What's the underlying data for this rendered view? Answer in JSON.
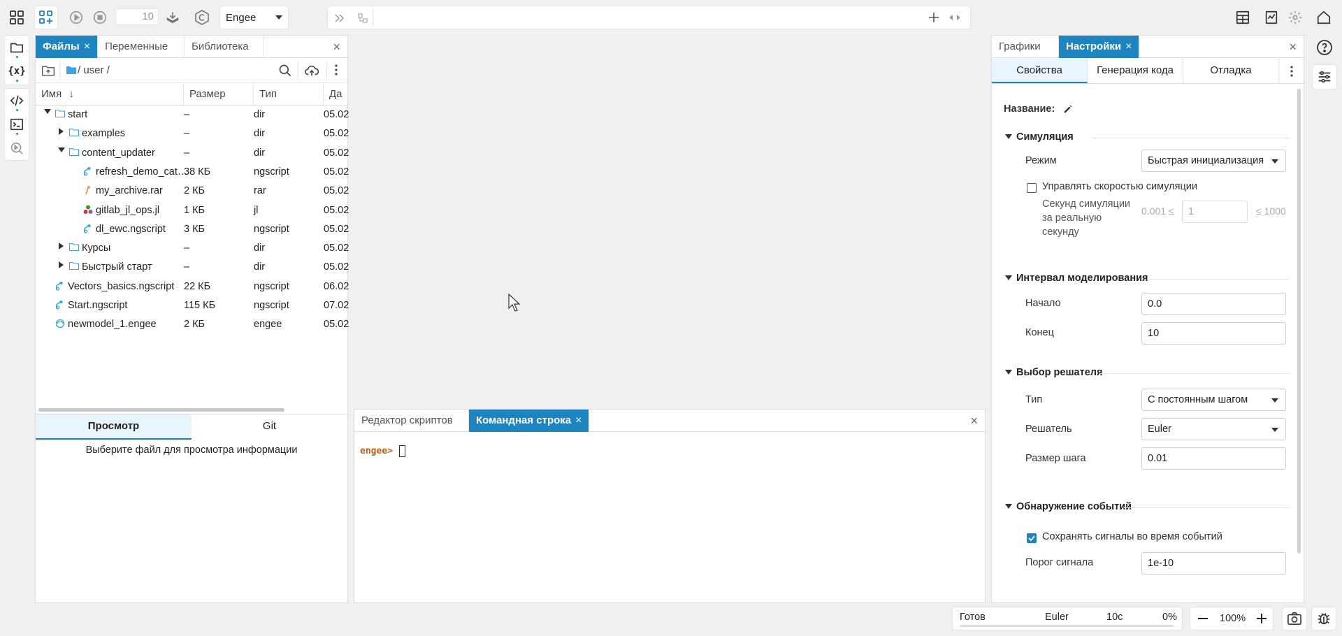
{
  "toolbar": {
    "step_value": "10",
    "engine": "Engee"
  },
  "files_panel": {
    "tabs": [
      {
        "label": "Файлы",
        "active": true
      },
      {
        "label": "Переменные",
        "active": false
      },
      {
        "label": "Библиотека",
        "active": false
      }
    ],
    "path": "/ user /",
    "columns": [
      "Имя",
      "Размер",
      "Тип",
      "Да"
    ],
    "rows": [
      {
        "name": "start",
        "size": "–",
        "type": "dir",
        "date": "05.02"
      },
      {
        "name": "examples",
        "size": "–",
        "type": "dir",
        "date": "05.02"
      },
      {
        "name": "content_updater",
        "size": "–",
        "type": "dir",
        "date": "05.02"
      },
      {
        "name": "refresh_demo_cat…",
        "size": "38 КБ",
        "type": "ngscript",
        "date": "05.02"
      },
      {
        "name": "my_archive.rar",
        "size": "2 КБ",
        "type": "rar",
        "date": "05.02"
      },
      {
        "name": "gitlab_jl_ops.jl",
        "size": "1 КБ",
        "type": "jl",
        "date": "05.02"
      },
      {
        "name": "dl_ewc.ngscript",
        "size": "3 КБ",
        "type": "ngscript",
        "date": "05.02"
      },
      {
        "name": "Курсы",
        "size": "–",
        "type": "dir",
        "date": "05.02"
      },
      {
        "name": "Быстрый старт",
        "size": "–",
        "type": "dir",
        "date": "05.02"
      },
      {
        "name": "Vectors_basics.ngscript",
        "size": "22 КБ",
        "type": "ngscript",
        "date": "06.02"
      },
      {
        "name": "Start.ngscript",
        "size": "115 КБ",
        "type": "ngscript",
        "date": "07.02"
      },
      {
        "name": "newmodel_1.engee",
        "size": "2 КБ",
        "type": "engee",
        "date": "05.02"
      }
    ],
    "sub_tabs": [
      {
        "label": "Просмотр",
        "active": true
      },
      {
        "label": "Git",
        "active": false
      }
    ],
    "preview_message": "Выберите файл для просмотра информации"
  },
  "console_panel": {
    "tabs": [
      {
        "label": "Редактор скриптов",
        "active": false
      },
      {
        "label": "Командная строка",
        "active": true
      }
    ],
    "prompt": "engee>"
  },
  "settings_panel": {
    "tabs": [
      {
        "label": "Графики",
        "active": false
      },
      {
        "label": "Настройки",
        "active": true
      }
    ],
    "sub_tabs": [
      {
        "label": "Свойства",
        "active": true
      },
      {
        "label": "Генерация кода",
        "active": false
      },
      {
        "label": "Отладка",
        "active": false
      }
    ],
    "name_label": "Название:",
    "simulation": {
      "title": "Симуляция",
      "mode_label": "Режим",
      "mode_value": "Быстрая инициализация",
      "control_speed_label": "Управлять скоростью симуляции",
      "control_speed_checked": false,
      "speed_label_1": "Секунд симуляции",
      "speed_label_2": "за реальную",
      "speed_label_3": "секунду",
      "speed_min": "0.001 ≤",
      "speed_value": "1",
      "speed_max": "≤ 1000"
    },
    "interval": {
      "title": "Интервал моделирования",
      "start_label": "Начало",
      "start_value": "0.0",
      "end_label": "Конец",
      "end_value": "10"
    },
    "solver": {
      "title": "Выбор решателя",
      "type_label": "Тип",
      "type_value": "С постоянным шагом",
      "solver_label": "Решатель",
      "solver_value": "Euler",
      "step_label": "Размер шага",
      "step_value": "0.01"
    },
    "events": {
      "title": "Обнаружение событий",
      "save_signals_label": "Сохранять сигналы во время событий",
      "save_signals_checked": true,
      "threshold_label": "Порог сигнала",
      "threshold_value": "1e-10"
    }
  },
  "status_bar": {
    "state": "Готов",
    "solver": "Euler",
    "time": "10с",
    "progress": "0%",
    "zoom": "100%"
  },
  "colors": {
    "accent": "#1d84c0",
    "prompt": "#c0601a"
  }
}
